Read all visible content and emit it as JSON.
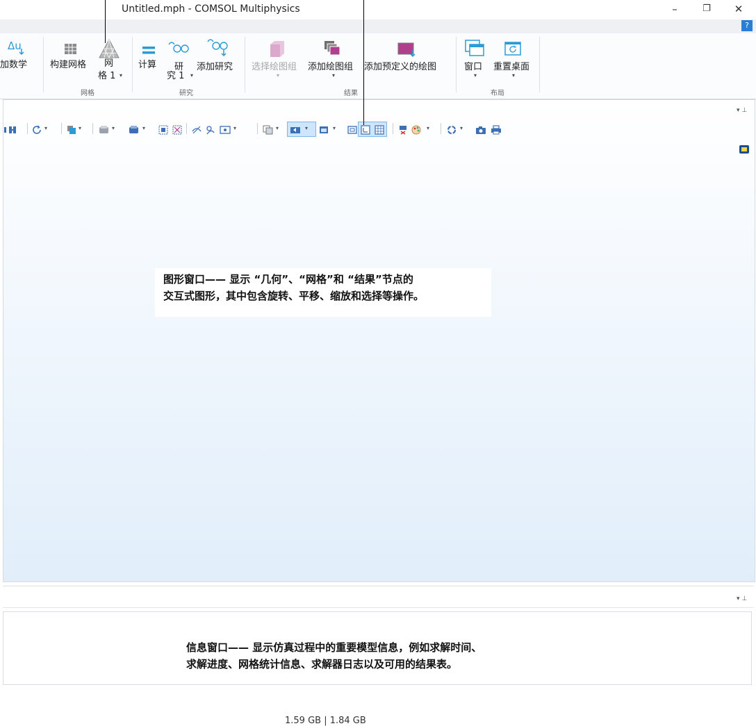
{
  "window": {
    "title": "Untitled.mph - COMSOL Multiphysics",
    "minimize_glyph": "–",
    "restore_glyph": "❐",
    "close_glyph": "✕",
    "help_glyph": "?"
  },
  "ribbon": {
    "add_math_label": "添加数学",
    "build_mesh_label": "构建网格",
    "mesh1_label_top": "网",
    "mesh1_label_bottom": "格 1",
    "mesh_group": "网格",
    "compute_label": "计算",
    "study1_label_top": "研",
    "study1_label_bottom": "究 1",
    "add_study_label": "添加研究",
    "study_group": "研究",
    "select_plot_group_label": "选择绘图组",
    "add_plot_group_label": "添加绘图组",
    "add_predefined_plot_label": "添加预定义的绘图",
    "results_group": "结果",
    "windows_label": "窗口",
    "reset_desktop_label": "重置桌面",
    "layout_group": "布局"
  },
  "graphics": {
    "callout_line1": "图形窗口—— 显示 “几何”、“网格”和 “结果”节点的",
    "callout_line2": "交互式图形，其中包含旋转、平移、缩放和选择等操作。"
  },
  "info": {
    "callout_line1": "信息窗口—— 显示仿真过程中的重要模型信息，例如求解时间、",
    "callout_line2": "求解进度、网格统计信息、求解器日志以及可用的结果表。"
  },
  "status": {
    "memory": "1.59 GB | 1.84 GB"
  },
  "colors": {
    "accent": "#2a7fd4",
    "teal": "#2b9bd8",
    "magenta": "#b0408e",
    "graphics_top": "#ffffff",
    "graphics_bottom": "#e1eefa"
  }
}
